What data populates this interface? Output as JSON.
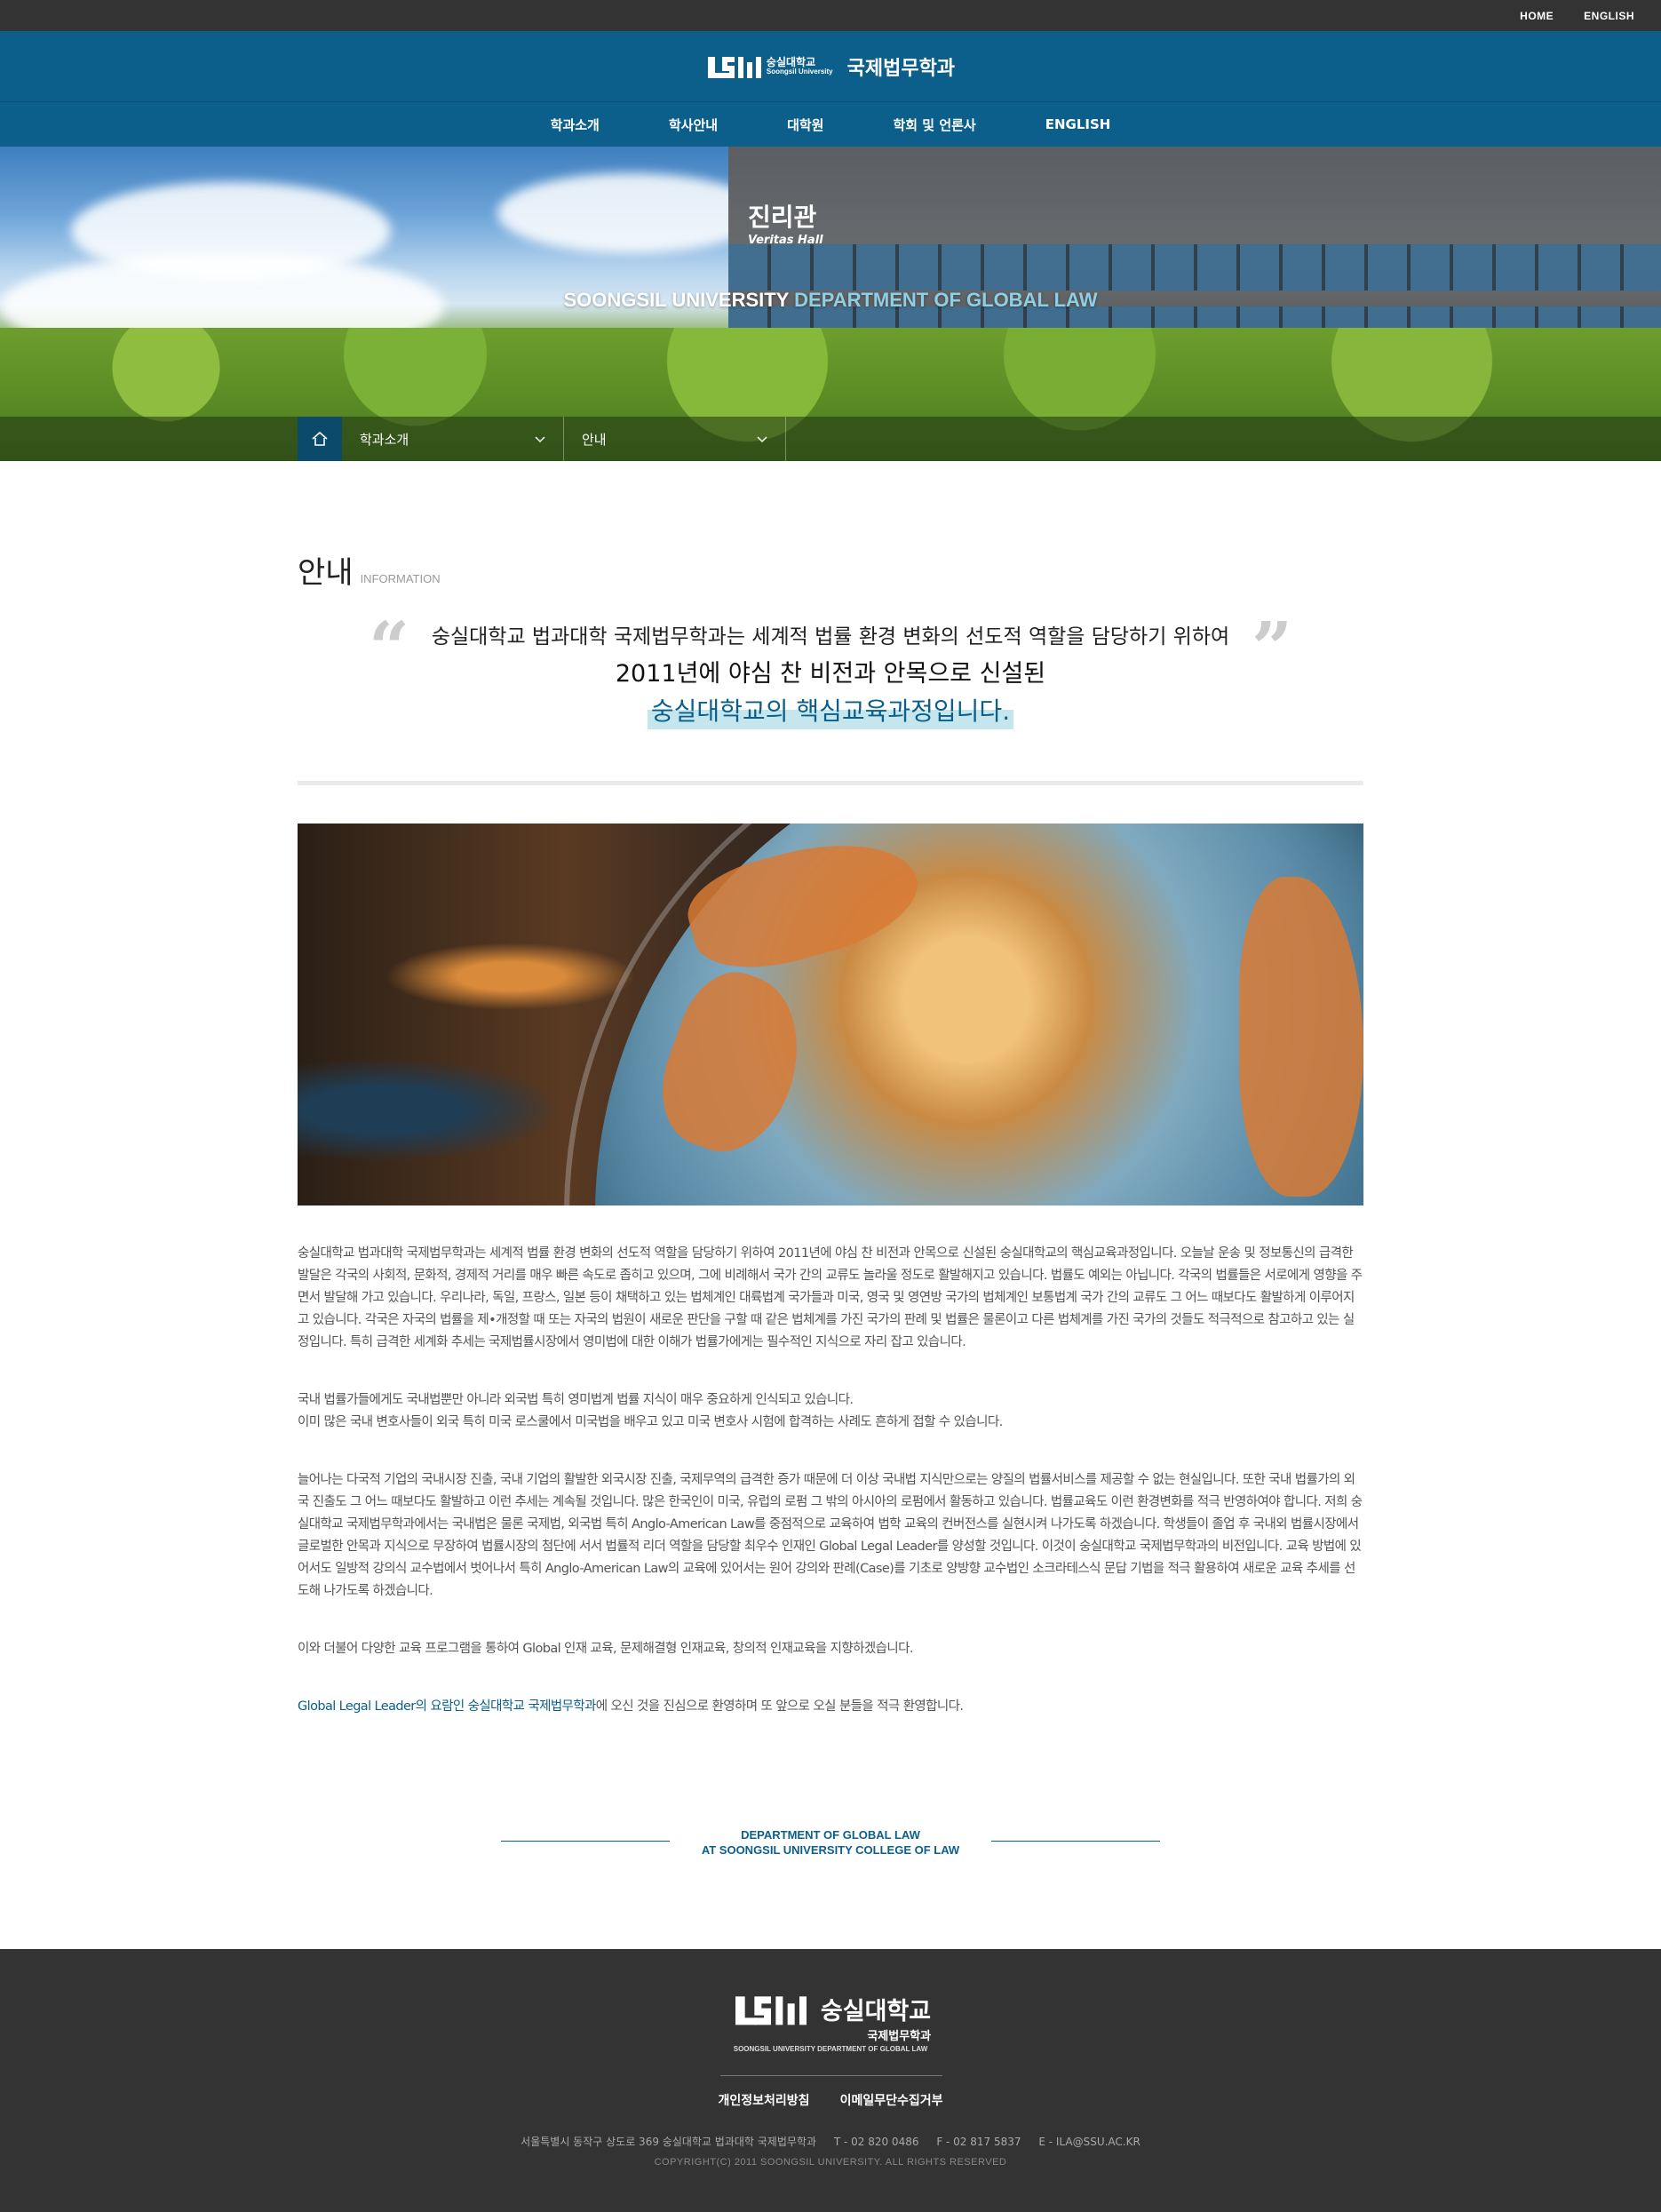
{
  "util_nav": {
    "home": "HOME",
    "english": "ENGLISH"
  },
  "header": {
    "logo_ko": "숭실대학교",
    "logo_en": "Soongsil University",
    "dept_name": "국제법무학과"
  },
  "gnb": [
    "학과소개",
    "학사안내",
    "대학원",
    "학회 및 언론사",
    "ENGLISH"
  ],
  "hero": {
    "sign_ko": "진리관",
    "sign_en": "Veritas Hall",
    "tagline_white": "SOONGSIL UNIVERSITY",
    "tagline_blue": "DEPARTMENT OF GLOBAL LAW"
  },
  "location": {
    "depth1": "학과소개",
    "depth2": "안내"
  },
  "page": {
    "title": "안내",
    "subtitle": "INFORMATION"
  },
  "quote": {
    "line1": "숭실대학교 법과대학 국제법무학과는 세계적 법률 환경 변화의 선도적 역할을 담당하기 위하여",
    "line2": "2011년에 야심 찬 비전과 안목으로 신설된",
    "line3": "숭실대학교의 핵심교육과정입니다."
  },
  "body": {
    "p1": "숭실대학교 법과대학 국제법무학과는 세계적 법률 환경 변화의 선도적 역할을 담당하기 위하여 2011년에 야심 찬 비전과 안목으로 신설된 숭실대학교의 핵심교육과정입니다. 오늘날 운송 및 정보통신의 급격한 발달은 각국의 사회적, 문화적, 경제적 거리를 매우 빠른 속도로 좁히고 있으며, 그에 비례해서 국가 간의 교류도 놀라울 정도로 활발해지고 있습니다. 법률도 예외는 아닙니다. 각국의 법률들은 서로에게 영향을 주면서 발달해 가고 있습니다. 우리나라, 독일, 프랑스, 일본 등이 채택하고 있는 법체계인 대륙법계 국가들과 미국, 영국 및 영연방 국가의 법체계인 보통법계 국가 간의 교류도 그 어느 때보다도 활발하게 이루어지고 있습니다. 각국은 자국의 법률을 제•개정할 때 또는 자국의 법원이 새로운 판단을 구할 때 같은 법체계를 가진 국가의 판례 및 법률은 물론이고 다른 법체계를 가진 국가의 것들도 적극적으로 참고하고 있는 실정입니다. 특히 급격한 세계화 추세는 국제법률시장에서 영미법에 대한 이해가 법률가에게는 필수적인 지식으로 자리 잡고 있습니다.",
    "p2a": "국내 법률가들에게도 국내법뿐만 아니라 외국법 특히 영미법계 법률 지식이 매우 중요하게 인식되고 있습니다.",
    "p2b": "이미 많은 국내 변호사들이 외국 특히 미국 로스쿨에서 미국법을 배우고 있고 미국 변호사 시험에 합격하는 사례도 흔하게 접할 수 있습니다.",
    "p3": "늘어나는 다국적 기업의 국내시장 진출, 국내 기업의 활발한 외국시장 진출, 국제무역의 급격한 증가 때문에 더 이상 국내법 지식만으로는 양질의 법률서비스를 제공할 수 없는 현실입니다. 또한 국내 법률가의 외국 진출도 그 어느 때보다도 활발하고 이런 추세는 계속될 것입니다. 많은 한국인이 미국, 유럽의 로펌 그 밖의 아시아의 로펌에서 활동하고 있습니다. 법률교육도 이런 환경변화를 적극 반영하여야 합니다. 저희 숭실대학교 국제법무학과에서는 국내법은 물론 국제법, 외국법 특히 Anglo-American Law를 중점적으로 교육하여 법학 교육의 컨버전스를 실현시켜 나가도록 하겠습니다. 학생들이 졸업 후 국내외 법률시장에서 글로벌한 안목과 지식으로 무장하여 법률시장의 첨단에 서서 법률적 리더 역할을 담당할 최우수 인재인 Global Legal Leader를 양성할 것입니다. 이것이 숭실대학교 국제법무학과의 비전입니다. 교육 방법에 있어서도 일방적 강의식 교수법에서 벗어나서 특히 Anglo-American Law의 교육에 있어서는 원어 강의와 판례(Case)를 기초로 양방향 교수법인 소크라테스식 문답 기법을 적극 활용하여 새로운 교육 추세를 선도해 나가도록 하겠습니다.",
    "p4": "이와 더불어 다양한 교육 프로그램을 통하여 Global 인재 교육, 문제해결형 인재교육, 창의적 인재교육을 지향하겠습니다.",
    "p5_highlight": "Global Legal Leader의 요람인 숭실대학교 국제법무학과",
    "p5_rest": "에 오신 것을 진심으로 환영하며 또 앞으로 오실 분들을 적극 환영합니다."
  },
  "dept_sign": {
    "line1": "DEPARTMENT OF GLOBAL LAW",
    "line2": "AT SOONGSIL UNIVERSITY COLLEGE OF LAW"
  },
  "footer": {
    "logo_ko": "숭실대학교",
    "logo_dept": "국제법무학과",
    "en_line": "SOONGSIL UNIVERSITY DEPARTMENT OF GLOBAL LAW",
    "links": [
      "개인정보처리방침",
      "이메일무단수집거부"
    ],
    "address": "서울특별시 동작구 상도로 369 숭실대학교 법과대학 국제법무학과",
    "tel": "T - 02 820 0486",
    "fax": "F - 02 817 5837",
    "email": "E - ILA@SSU.AC.KR",
    "copyright": "COPYRIGHT(C) 2011 SOONGSIL UNIVERSITY. ALL RIGHTS RESERVED"
  },
  "colors": {
    "primary": "#0b5f8a",
    "dark": "#333333",
    "highlight": "#c6e6ee"
  }
}
